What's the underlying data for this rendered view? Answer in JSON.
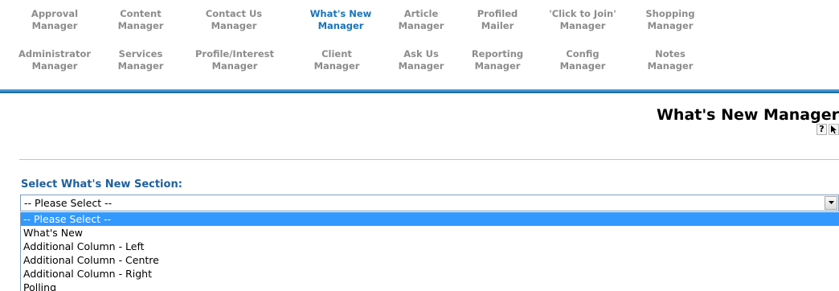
{
  "nav": {
    "row1": [
      {
        "line1": "Approval",
        "line2": "Manager"
      },
      {
        "line1": "Content",
        "line2": "Manager"
      },
      {
        "line1": "Contact Us",
        "line2": "Manager"
      },
      {
        "line1": "What's New",
        "line2": "Manager"
      },
      {
        "line1": "Article",
        "line2": "Manager"
      },
      {
        "line1": "Profiled",
        "line2": "Mailer"
      },
      {
        "line1": "'Click to Join'",
        "line2": "Manager"
      },
      {
        "line1": "Shopping",
        "line2": "Manager"
      }
    ],
    "row2": [
      {
        "line1": "Administrator",
        "line2": "Manager"
      },
      {
        "line1": "Services",
        "line2": "Manager"
      },
      {
        "line1": "Profile/Interest",
        "line2": "Manager"
      },
      {
        "line1": "Client",
        "line2": "Manager"
      },
      {
        "line1": "Ask Us",
        "line2": "Manager"
      },
      {
        "line1": "Reporting",
        "line2": "Manager"
      },
      {
        "line1": "Config",
        "line2": "Manager"
      },
      {
        "line1": "Notes",
        "line2": "Manager"
      }
    ],
    "active": "What's New Manager",
    "colors": {
      "inactive": "#8c8c8c",
      "active": "#1a74b8",
      "rule": "#2e86c8"
    }
  },
  "page": {
    "title": "What's New Manager",
    "help_icon": "?",
    "icons": [
      "help-icon",
      "pointer-arrow-icon"
    ]
  },
  "section": {
    "label": "Select What's New Section:",
    "select": {
      "value": "-- Please Select --",
      "options": [
        "-- Please Select --",
        "What's New",
        "Additional Column - Left",
        "Additional Column - Centre",
        "Additional Column - Right",
        "Polling"
      ],
      "selected_index": 0,
      "highlight_color": "#3399ff"
    }
  }
}
